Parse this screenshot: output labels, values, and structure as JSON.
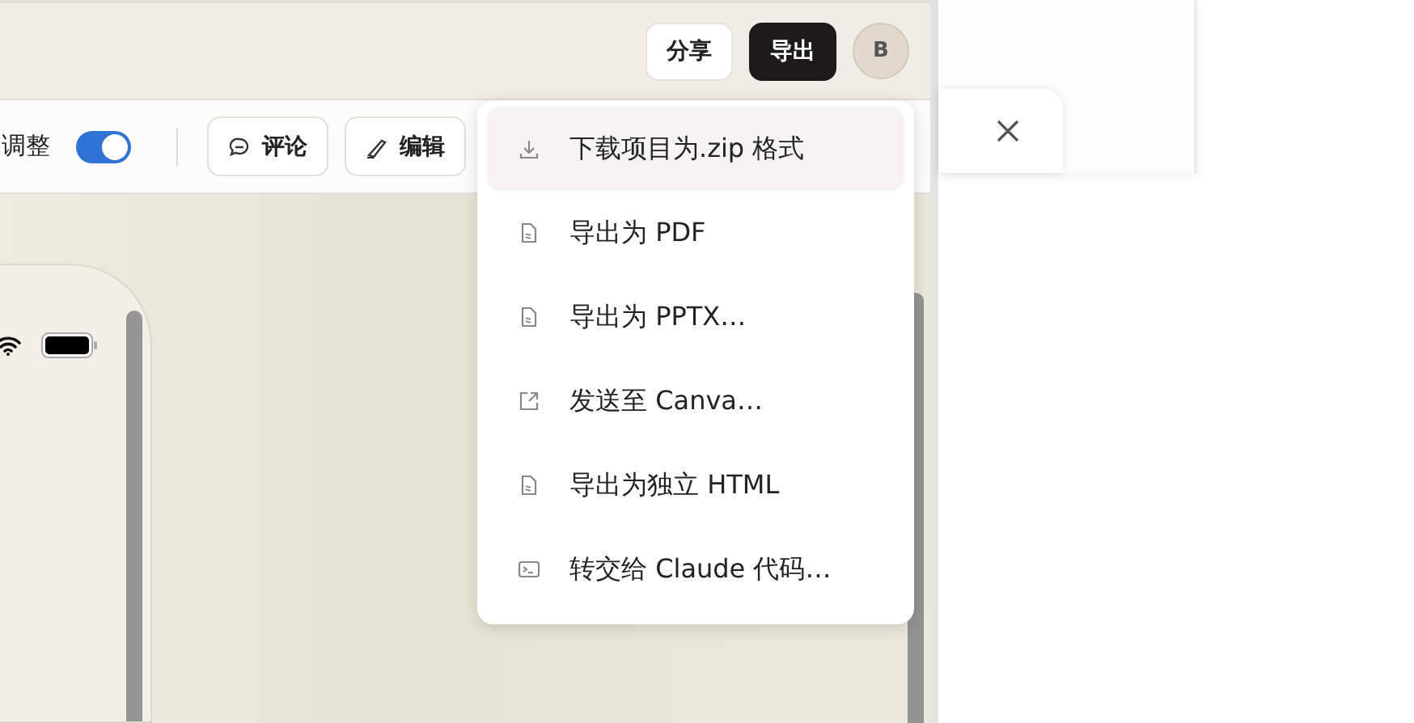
{
  "top_bar": {
    "share_button": "分享",
    "export_button": {
      "label": "导出",
      "active": true
    },
    "avatar": "B"
  },
  "toolbar": {
    "adjust": {
      "label": "调整",
      "on": true
    },
    "buttons": [
      {
        "label": "评论",
        "kind": "comment"
      },
      {
        "label": "编辑",
        "kind": "edit"
      }
    ]
  },
  "export_menu": {
    "items": [
      {
        "label": "下载项目为.zip 格式",
        "kind": "download",
        "highlighted": true
      },
      {
        "label": "导出为 PDF",
        "kind": "document",
        "highlighted": false
      },
      {
        "label": "导出为 PPTX…",
        "kind": "document",
        "highlighted": false
      },
      {
        "label": "发送至 Canva…",
        "kind": "external",
        "highlighted": false
      },
      {
        "label": "导出为独立 HTML",
        "kind": "document",
        "highlighted": false
      },
      {
        "label": "转交给 Claude 代码…",
        "kind": "terminal",
        "highlighted": false
      }
    ]
  }
}
